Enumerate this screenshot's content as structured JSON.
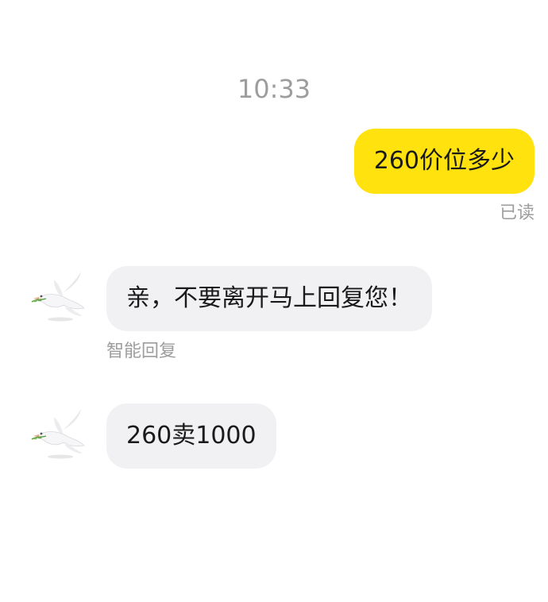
{
  "chat": {
    "timestamp": "10:33",
    "messages": [
      {
        "direction": "outgoing",
        "text": "260价位多少",
        "status": "已读",
        "bubble_color": "#ffe20e"
      },
      {
        "direction": "incoming",
        "text": "亲，不要离开马上回复您！",
        "sub_label": "智能回复",
        "avatar_icon": "dove-avatar-icon",
        "bubble_color": "#f1f1f4"
      },
      {
        "direction": "incoming",
        "text": "260卖1000",
        "avatar_icon": "dove-avatar-icon",
        "bubble_color": "#f1f1f4"
      }
    ]
  }
}
